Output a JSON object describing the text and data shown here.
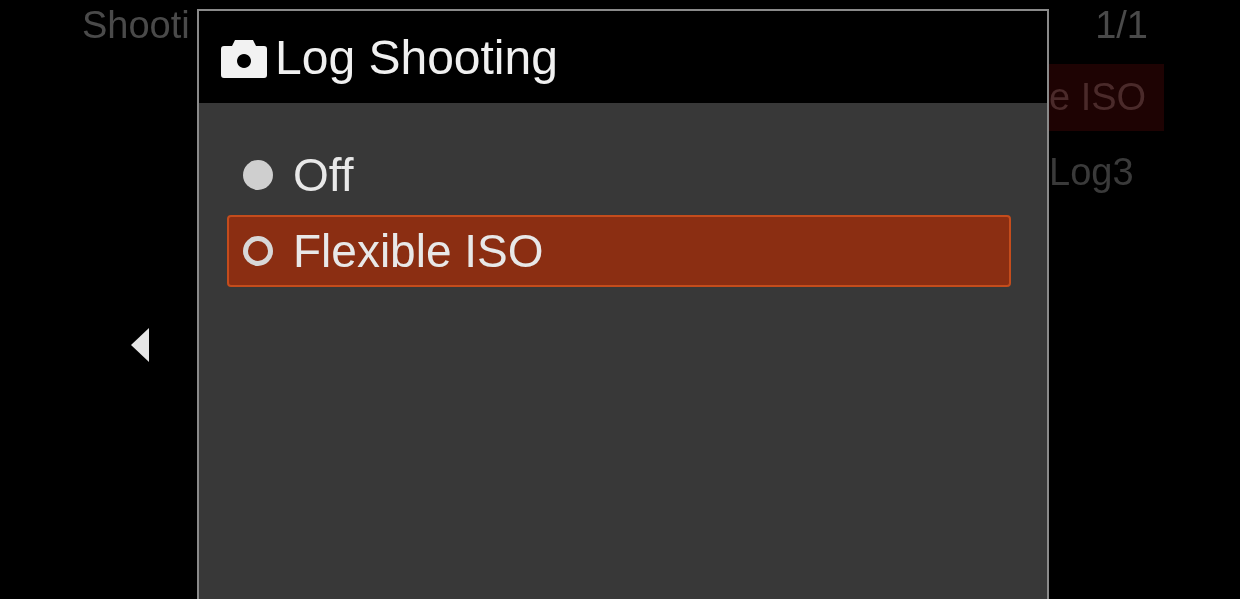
{
  "background_menu": {
    "title": "Shooti",
    "page": "1/1",
    "rows": [
      {
        "value": "e ISO",
        "selected": true
      },
      {
        "value": "Log3",
        "selected": false
      }
    ]
  },
  "dialog": {
    "title": "Log Shooting",
    "options": [
      {
        "label": "Off",
        "selected": false
      },
      {
        "label": "Flexible ISO",
        "selected": true
      }
    ]
  }
}
